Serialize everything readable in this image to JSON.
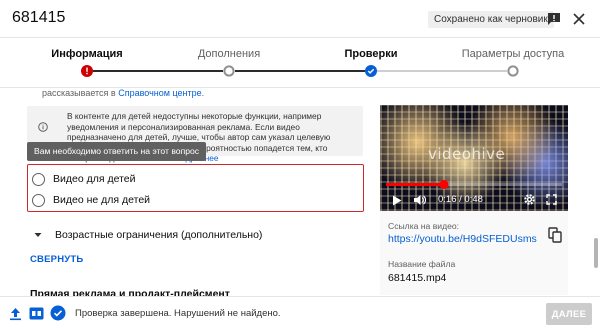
{
  "header": {
    "title": "681415",
    "draft_badge": "Сохранено как черновик"
  },
  "stepper": {
    "steps": [
      {
        "label": "Информация",
        "state": "error"
      },
      {
        "label": "Дополнения",
        "state": "pending"
      },
      {
        "label": "Проверки",
        "state": "done"
      },
      {
        "label": "Параметры доступа",
        "state": "pending"
      }
    ],
    "colors": {
      "error": "#cc0000",
      "done": "#065fd4",
      "pending": "#909090"
    }
  },
  "content": {
    "cut_text_prefix": "рассказывается в ",
    "cut_text_link": "Справочном центре",
    "cut_text_suffix": ".",
    "info_text": "В контенте для детей недоступны некоторые функции, например уведомления и персонализированная реклама. Если видео предназначено для детей, лучше, чтобы автор сам указал целевую аудиторию. Тогда оно с большей вероятностью попадется тем, кто смотрят подобный контент.",
    "info_link": "Подробнее",
    "tooltip": "Вам необходимо ответить на этот вопрос",
    "radio_options": [
      "Видео для детей",
      "Видео не для детей"
    ],
    "age_restrictions": "Возрастные ограничения (дополнительно)",
    "collapse_link": "СВЕРНУТЬ",
    "promo_heading": "Прямая реклама и продакт-плейсмент"
  },
  "video": {
    "watermark": "videohive",
    "time": "0:16 / 0:48",
    "progress_fraction": 0.33,
    "link_label": "Ссылка на видео:",
    "url": "https://youtu.be/H9dSFEDUsms",
    "file_label": "Название файла",
    "file_name": "681415.mp4"
  },
  "footer": {
    "status": "Проверка завершена. Нарушений не найдено.",
    "next_label": "ДАЛЕЕ"
  }
}
